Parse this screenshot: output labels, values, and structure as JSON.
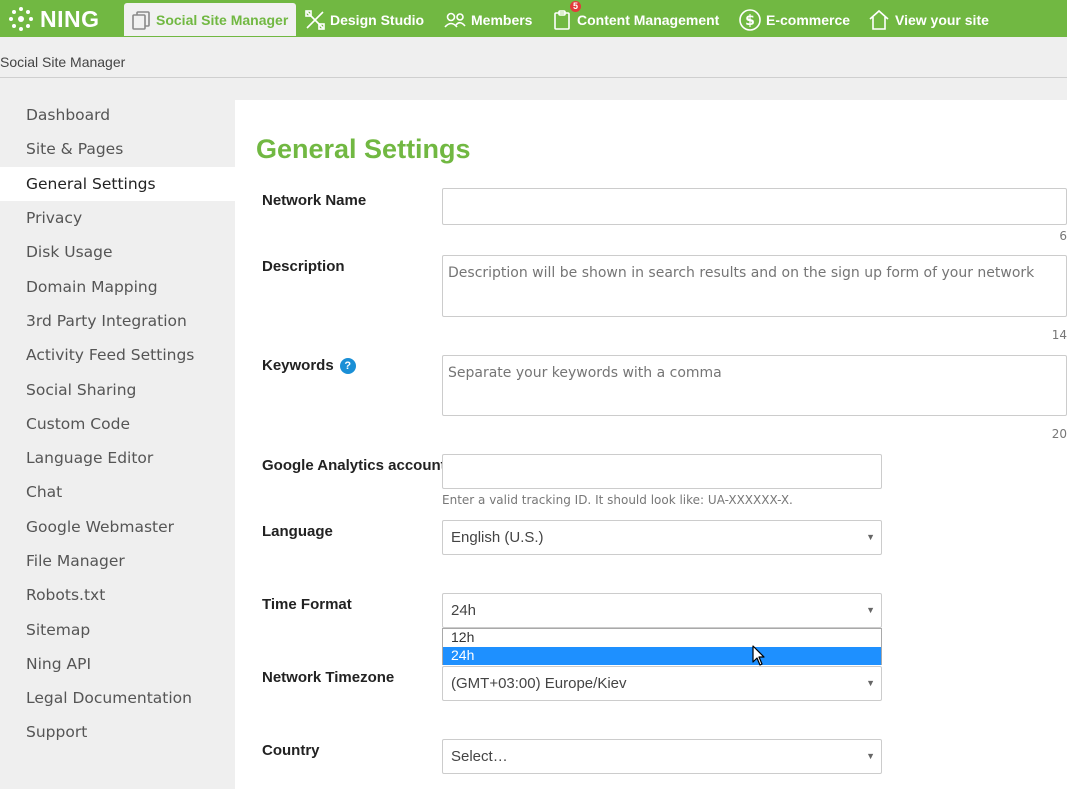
{
  "brand": {
    "logo_text": "NING"
  },
  "topnav": {
    "items": [
      {
        "label": "Social Site Manager",
        "icon": "pages-icon",
        "active": true
      },
      {
        "label": "Design Studio",
        "icon": "design-tools-icon"
      },
      {
        "label": "Members",
        "icon": "members-icon"
      },
      {
        "label": "Content Management",
        "icon": "clipboard-icon",
        "badge": "5"
      },
      {
        "label": "E-commerce",
        "icon": "dollar-icon"
      },
      {
        "label": "View your site",
        "icon": "home-icon"
      }
    ]
  },
  "breadcrumb": "Social Site Manager",
  "sidebar": {
    "items": [
      {
        "label": "Dashboard"
      },
      {
        "label": "Site & Pages"
      },
      {
        "label": "General Settings",
        "active": true
      },
      {
        "label": "Privacy"
      },
      {
        "label": "Disk Usage"
      },
      {
        "label": "Domain Mapping"
      },
      {
        "label": "3rd Party Integration"
      },
      {
        "label": "Activity Feed Settings"
      },
      {
        "label": "Social Sharing"
      },
      {
        "label": "Custom Code"
      },
      {
        "label": "Language Editor"
      },
      {
        "label": "Chat"
      },
      {
        "label": "Google Webmaster"
      },
      {
        "label": "File Manager"
      },
      {
        "label": "Robots.txt"
      },
      {
        "label": "Sitemap"
      },
      {
        "label": "Ning API"
      },
      {
        "label": "Legal Documentation"
      },
      {
        "label": "Support"
      }
    ]
  },
  "main": {
    "title": "General Settings",
    "network_name": {
      "label": "Network Name",
      "value": "",
      "counter": "6"
    },
    "description": {
      "label": "Description",
      "placeholder": "Description will be shown in search results and on the sign up form of your network",
      "counter": "14"
    },
    "keywords": {
      "label": "Keywords",
      "help": "?",
      "placeholder": "Separate your keywords with a comma",
      "counter": "20"
    },
    "analytics": {
      "label": "Google Analytics account",
      "value": "",
      "hint": "Enter a valid tracking ID. It should look like: UA-XXXXXX-X."
    },
    "language": {
      "label": "Language",
      "value": "English (U.S.)"
    },
    "time_format": {
      "label": "Time Format",
      "value": "24h",
      "options": [
        "12h",
        "24h"
      ]
    },
    "timezone": {
      "label": "Network Timezone",
      "value": "(GMT+03:00) Europe/Kiev"
    },
    "country": {
      "label": "Country",
      "value": "Select…"
    }
  },
  "colors": {
    "brand_green": "#71b842",
    "selection_blue": "#1e90ff"
  }
}
